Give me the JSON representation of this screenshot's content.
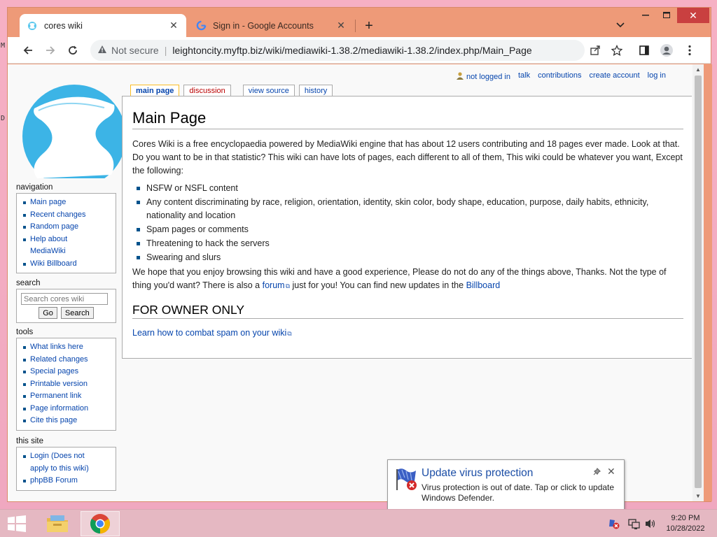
{
  "desktop": {
    "marks": [
      "M",
      "D"
    ]
  },
  "browser": {
    "tabs": [
      {
        "title": "cores wiki",
        "active": true
      },
      {
        "title": "Sign in - Google Accounts",
        "active": false
      }
    ],
    "omnibox": {
      "security": "Not secure",
      "separator": "|",
      "url": "leightoncity.myftp.biz/wiki/mediawiki-1.38.2/mediawiki-1.38.2/index.php/Main_Page"
    }
  },
  "wiki": {
    "personal": {
      "not_logged_in": "not logged in",
      "talk": "talk",
      "contributions": "contributions",
      "create_account": "create account",
      "log_in": "log in"
    },
    "ctabs": {
      "main_page": "main page",
      "discussion": "discussion",
      "view_source": "view source",
      "history": "history"
    },
    "navigation": {
      "heading": "navigation",
      "items": [
        "Main page",
        "Recent changes",
        "Random page",
        "Help about",
        "MediaWiki",
        "Wiki Billboard"
      ]
    },
    "search": {
      "heading": "search",
      "placeholder": "Search cores wiki",
      "go": "Go",
      "search": "Search"
    },
    "tools": {
      "heading": "tools",
      "items": [
        "What links here",
        "Related changes",
        "Special pages",
        "Printable version",
        "Permanent link",
        "Page information",
        "Cite this page"
      ]
    },
    "this_site": {
      "heading": "this site",
      "items": [
        "Login (Does not",
        "apply to this wiki)",
        "phpBB Forum"
      ]
    },
    "content": {
      "title": "Main Page",
      "intro": "Cores Wiki is a free encyclopaedia powered by MediaWiki engine that has about 12 users contributing and 18 pages ever made. Look at that. Do you want to be in that statistic? This wiki can have lots of pages, each different to all of them, This wiki could be whatever you want, Except the following:",
      "list": [
        "NSFW or NSFL content",
        "Any content discriminating by race, religion, orientation, identity, skin color, body shape, education, purpose, daily habits, ethnicity, nationality and location",
        "Spam pages or comments",
        "Threatening to hack the servers",
        "Swearing and slurs"
      ],
      "outro_a": "We hope that you enjoy browsing this wiki and have a good experience, Please do not do any of the things above, Thanks. Not the type of thing you'd want? There is also a ",
      "forum_link": "forum",
      "outro_b": " just for you! You can find new updates in the ",
      "billboard_link": "Billboard",
      "section_heading": "FOR OWNER ONLY",
      "spam_link": "Learn how to combat spam on your wiki"
    }
  },
  "notification": {
    "title": "Update virus protection",
    "body": "Virus protection is out of date. Tap or click to update Windows Defender."
  },
  "taskbar": {
    "time": "9:20 PM",
    "date": "10/28/2022"
  },
  "colors": {
    "link": "#0645ad",
    "newlink": "#ba0000",
    "tab_selected_border": "#fabd23",
    "browser_frame": "#ee9a78",
    "taskbar": "#e5b8c2"
  }
}
